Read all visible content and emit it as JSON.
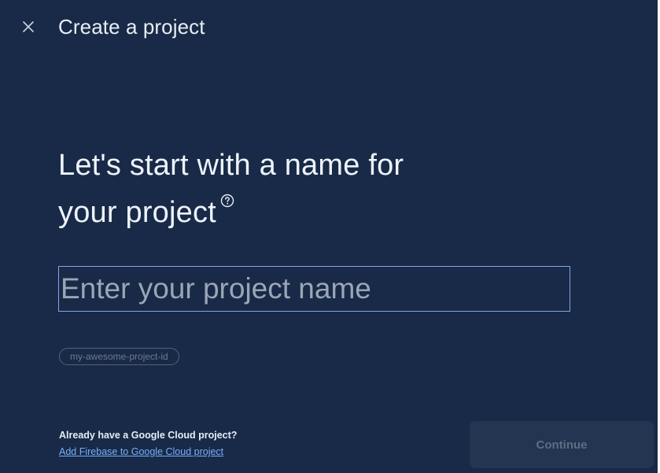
{
  "dialog": {
    "title": "Create a project",
    "close_icon": "close-icon"
  },
  "heading": {
    "line1": "Let's start with a name for",
    "line2": "your project",
    "help_icon": "help-circle-icon"
  },
  "project_name_input": {
    "value": "",
    "placeholder": "Enter your project name"
  },
  "project_id_chip": {
    "label": "my-awesome-project-id"
  },
  "footer": {
    "question": "Already have a Google Cloud project?",
    "link": "Add Firebase to Google Cloud project",
    "continue_label": "Continue",
    "continue_enabled": false
  },
  "colors": {
    "background": "#182a47",
    "input_border": "#7fa8e6",
    "link": "#79aefc",
    "continue_disabled_bg": "#233551",
    "continue_disabled_text": "#5d6d84"
  }
}
